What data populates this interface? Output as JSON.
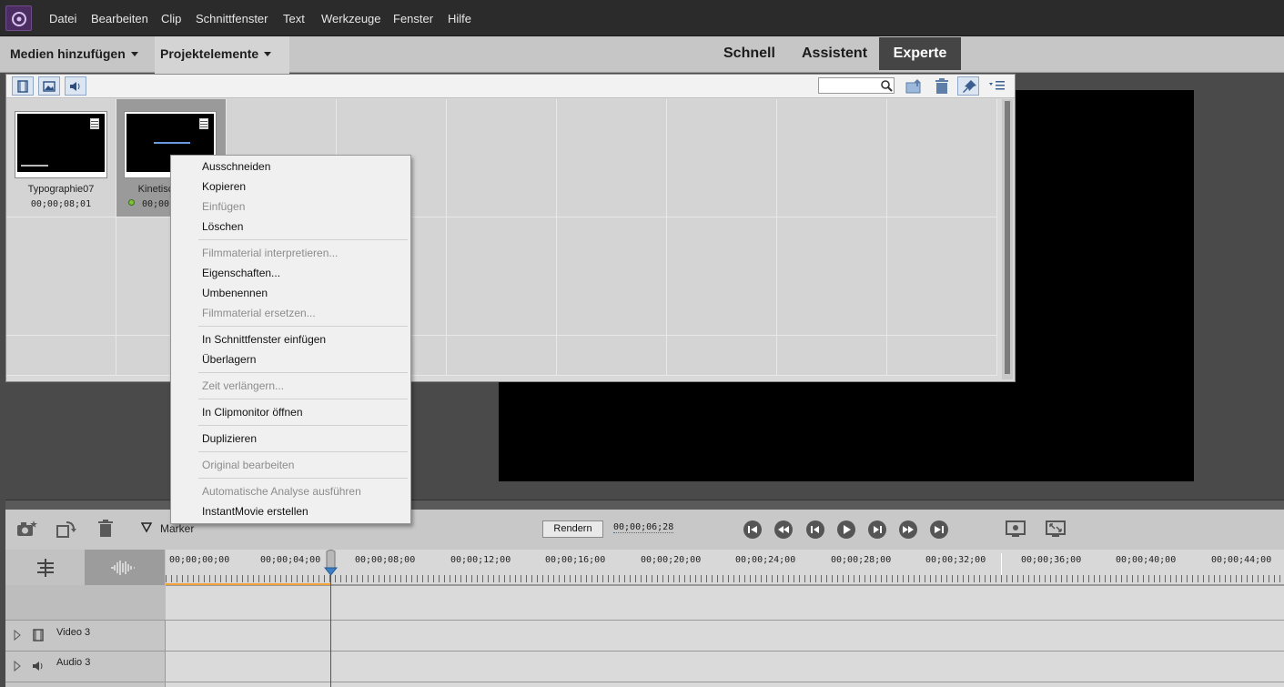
{
  "menubar": {
    "items": [
      "Datei",
      "Bearbeiten",
      "Clip",
      "Schnittfenster",
      "Text",
      "Werkzeuge",
      "Fenster",
      "Hilfe"
    ]
  },
  "modebar": {
    "add_media": "Medien hinzufügen",
    "project_elements": "Projektelemente",
    "modes": [
      "Schnell",
      "Assistent",
      "Experte"
    ],
    "active_mode": "Experte"
  },
  "project_panel": {
    "search_placeholder": "",
    "clips": [
      {
        "name": "Typographie07",
        "duration": "00;00;08;01"
      },
      {
        "name": "Kinetisch",
        "duration": "00;00;"
      }
    ]
  },
  "context_menu": {
    "items": [
      {
        "label": "Ausschneiden",
        "enabled": true
      },
      {
        "label": "Kopieren",
        "enabled": true
      },
      {
        "label": "Einfügen",
        "enabled": false
      },
      {
        "label": "Löschen",
        "enabled": true
      },
      {
        "label": "Filmmaterial interpretieren...",
        "enabled": false
      },
      {
        "label": "Eigenschaften...",
        "enabled": true
      },
      {
        "label": "Umbenennen",
        "enabled": true
      },
      {
        "label": "Filmmaterial ersetzen...",
        "enabled": false
      },
      {
        "label": "In Schnittfenster einfügen",
        "enabled": true
      },
      {
        "label": "Überlagern",
        "enabled": true
      },
      {
        "label": "Zeit verlängern...",
        "enabled": false
      },
      {
        "label": "In Clipmonitor öffnen",
        "enabled": true
      },
      {
        "label": "Duplizieren",
        "enabled": true
      },
      {
        "label": "Original bearbeiten",
        "enabled": false
      },
      {
        "label": "Automatische Analyse ausführen",
        "enabled": false
      },
      {
        "label": "InstantMovie erstellen",
        "enabled": true
      }
    ]
  },
  "timeline": {
    "marker_label": "Marker",
    "render_label": "Rendern",
    "current_time": "00;00;06;28",
    "ruler_labels": [
      "00;00;00;00",
      "00;00;04;00",
      "00;00;08;00",
      "00;00;12;00",
      "00;00;16;00",
      "00;00;20;00",
      "00;00;24;00",
      "00;00;28;00",
      "00;00;32;00",
      "00;00;36;00",
      "00;00;40;00",
      "00;00;44;00"
    ],
    "tracks": [
      "Video 3",
      "Audio 3"
    ]
  },
  "colors": {
    "accent_playhead": "#e01818",
    "work_area": "#f2a23a",
    "brand_logo": "#4b2d63"
  }
}
